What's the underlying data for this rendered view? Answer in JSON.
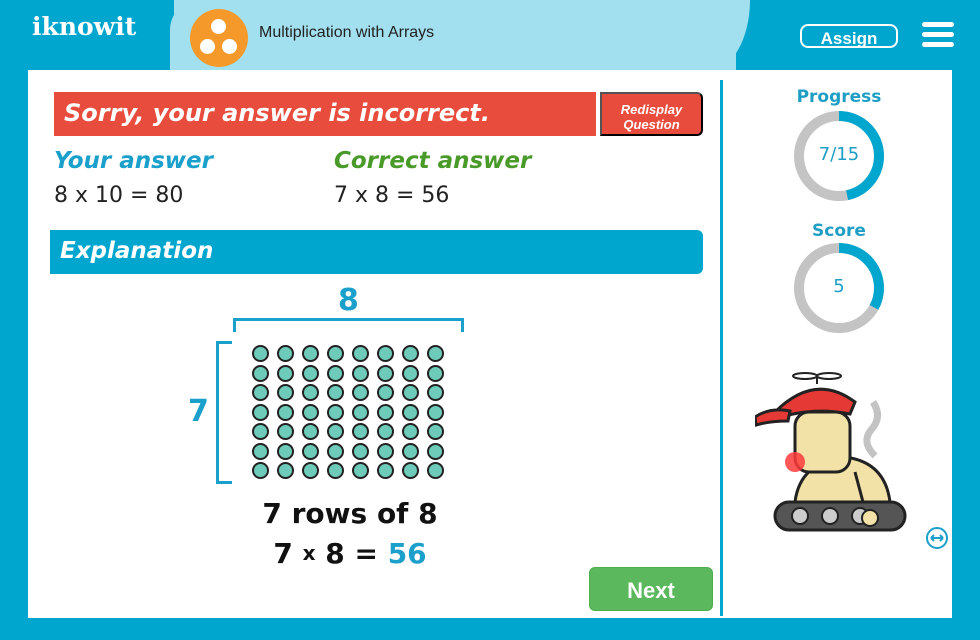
{
  "header": {
    "logo_text": "iknowit",
    "topic_title": "Multiplication with Arrays",
    "topic_icon": "three-dots-icon",
    "assign_label": "Assign",
    "menu_icon": "hamburger-menu-icon"
  },
  "feedback": {
    "message": "Sorry, your answer is incorrect.",
    "redisplay_label_line1": "Redisplay",
    "redisplay_label_line2": "Question",
    "your_answer_label": "Your answer",
    "your_answer_value": "8 x 10 = 80",
    "correct_answer_label": "Correct answer",
    "correct_answer_value": "7 x 8 = 56"
  },
  "explanation": {
    "heading": "Explanation",
    "columns_label": "8",
    "rows_label": "7",
    "array_rows": 7,
    "array_cols": 8,
    "summary": "7 rows of 8",
    "equation_left": "7",
    "equation_times": "x",
    "equation_mid": "8 =",
    "equation_result": "56"
  },
  "sidebar": {
    "progress_label": "Progress",
    "progress_text": "7/15",
    "progress_done": 7,
    "progress_total": 15,
    "score_label": "Score",
    "score_text": "5",
    "score_fraction": 0.33
  },
  "actions": {
    "next_label": "Next"
  },
  "colors": {
    "brand_blue": "#00a6ce",
    "error_red": "#e84c3d",
    "correct_green": "#4a9a2a",
    "your_answer_blue": "#1ba0cb",
    "next_green": "#5cb85c",
    "dot_fill": "#6ecbb9",
    "ring_track": "#c4c4c4"
  }
}
